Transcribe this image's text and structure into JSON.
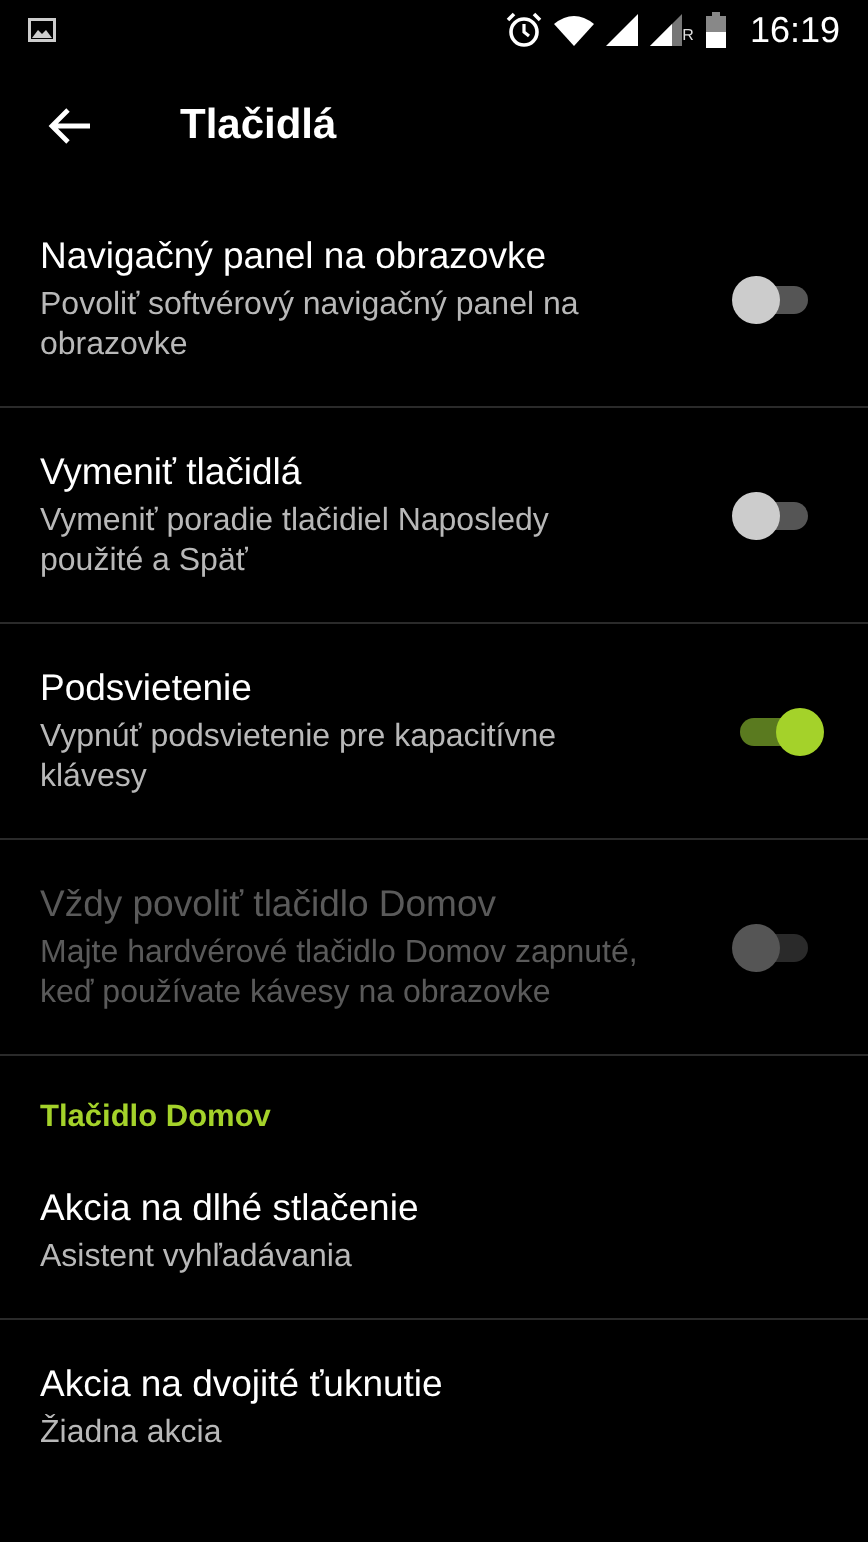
{
  "status_bar": {
    "roaming_label": "R",
    "time": "16:19"
  },
  "toolbar": {
    "title": "Tlačidlá"
  },
  "items": [
    {
      "kind": "switch",
      "title": "Navigačný panel na obrazovke",
      "summary": "Povoliť softvérový navigačný panel na obrazovke",
      "on": false,
      "disabled": false
    },
    {
      "kind": "switch",
      "title": "Vymeniť tlačidlá",
      "summary": "Vymeniť poradie tlačidiel Naposledy použité a Späť",
      "on": false,
      "disabled": false
    },
    {
      "kind": "switch",
      "title": "Podsvietenie",
      "summary": "Vypnúť podsvietenie pre kapacitívne klávesy",
      "on": true,
      "disabled": false
    },
    {
      "kind": "switch",
      "title": "Vždy povoliť tlačidlo Domov",
      "summary": "Majte hardvérové tlačidlo Domov zapnuté, keď používate kávesy na obrazovke",
      "on": false,
      "disabled": true
    },
    {
      "kind": "category",
      "title": "Tlačidlo Domov"
    },
    {
      "kind": "text",
      "title": "Akcia na dlhé stlačenie",
      "summary": "Asistent vyhľadávania"
    },
    {
      "kind": "text",
      "title": "Akcia na dvojité ťuknutie",
      "summary": "Žiadna akcia"
    }
  ]
}
